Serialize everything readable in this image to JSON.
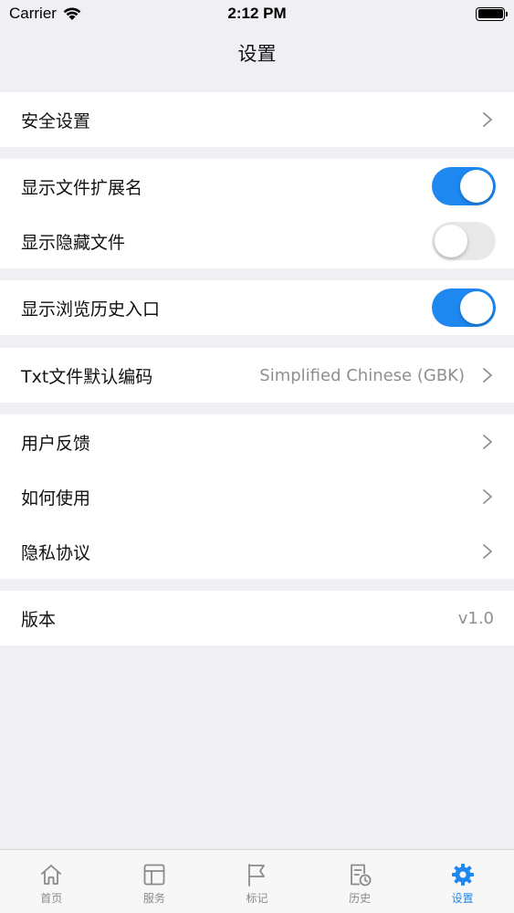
{
  "status": {
    "carrier": "Carrier",
    "time": "2:12 PM"
  },
  "nav": {
    "title": "设置"
  },
  "groups": {
    "security": {
      "label": "安全设置"
    },
    "files": {
      "show_extension": {
        "label": "显示文件扩展名",
        "on": true
      },
      "show_hidden": {
        "label": "显示隐藏文件",
        "on": false
      }
    },
    "history": {
      "show_history_entry": {
        "label": "显示浏览历史入口",
        "on": true
      }
    },
    "encoding": {
      "label": "Txt文件默认编码",
      "value": "Simplified Chinese (GBK)"
    },
    "support": {
      "feedback": {
        "label": "用户反馈"
      },
      "how_to_use": {
        "label": "如何使用"
      },
      "privacy": {
        "label": "隐私协议"
      }
    },
    "version": {
      "label": "版本",
      "value": "v1.0"
    }
  },
  "tabs": [
    {
      "label": "首页",
      "icon": "home-icon"
    },
    {
      "label": "服务",
      "icon": "services-icon"
    },
    {
      "label": "标记",
      "icon": "flag-icon"
    },
    {
      "label": "历史",
      "icon": "history-icon"
    },
    {
      "label": "设置",
      "icon": "gear-icon",
      "active": true
    }
  ],
  "colors": {
    "accent": "#1e88f0",
    "background": "#efeff4",
    "secondary_text": "#8e8e93"
  }
}
